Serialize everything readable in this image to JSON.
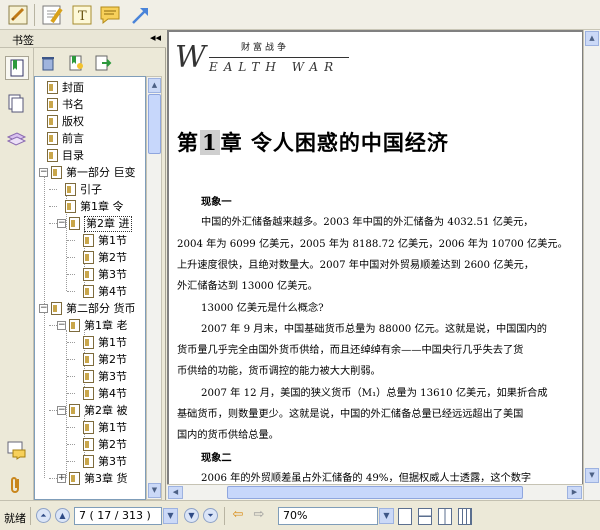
{
  "sidebar": {
    "title": "书签",
    "collapse_icon": "◂◂",
    "tree": [
      {
        "label": "封面",
        "level": 0
      },
      {
        "label": "书名",
        "level": 0
      },
      {
        "label": "版权",
        "level": 0
      },
      {
        "label": "前言",
        "level": 0
      },
      {
        "label": "目录",
        "level": 0
      },
      {
        "label": "第一部分  巨变",
        "level": 0,
        "expand": "−"
      },
      {
        "label": "引子",
        "level": 1
      },
      {
        "label": "第1章  令",
        "level": 1
      },
      {
        "label": "第2章  进",
        "level": 1,
        "expand": "−",
        "selected": true
      },
      {
        "label": "第1节",
        "level": 2
      },
      {
        "label": "第2节",
        "level": 2
      },
      {
        "label": "第3节",
        "level": 2
      },
      {
        "label": "第4节",
        "level": 2
      },
      {
        "label": "第二部分  货币",
        "level": 0,
        "expand": "−"
      },
      {
        "label": "第1章  老",
        "level": 1,
        "expand": "−"
      },
      {
        "label": "第1节",
        "level": 2
      },
      {
        "label": "第2节",
        "level": 2
      },
      {
        "label": "第3节",
        "level": 2
      },
      {
        "label": "第4节",
        "level": 2
      },
      {
        "label": "第2章  被",
        "level": 1,
        "expand": "−"
      },
      {
        "label": "第1节",
        "level": 2
      },
      {
        "label": "第2节",
        "level": 2
      },
      {
        "label": "第3节",
        "level": 2
      },
      {
        "label": "第3章  货",
        "level": 1,
        "expand": "+"
      }
    ]
  },
  "page": {
    "logo_cn": "财富战争",
    "logo_w": "W",
    "logo_rest": "EALTH  WAR",
    "chapter_prefix": "第",
    "chapter_num": "1",
    "chapter_suffix": "章  令人困惑的中国经济",
    "lines": [
      {
        "text": "现象一",
        "bold": true,
        "indent": 1
      },
      {
        "text": "中国的外汇储备越来越多。2003 年中国的外汇储备为 4032.51 亿美元，",
        "indent": 1
      },
      {
        "text": "2004 年为 6099 亿美元，2005 年为 8188.72 亿美元，2006 年为 10700 亿美元。",
        "indent": 0
      },
      {
        "text": "上升速度很快，且绝对数量大。2007 年中国对外贸易顺差达到 2600 亿美元，",
        "indent": 0
      },
      {
        "text": "外汇储备达到 13000 亿美元。",
        "indent": 0
      },
      {
        "text": "13000 亿美元是什么概念?",
        "indent": 1
      },
      {
        "text": "2007 年 9 月末，中国基础货币总量为 88000 亿元。这就是说，中国国内的",
        "indent": 1
      },
      {
        "text": "货币量几乎完全由国外货币供给，而且还绰绰有余——中国央行几乎失去了货",
        "indent": 0
      },
      {
        "text": "币供给的功能，货币调控的能力被大大削弱。",
        "indent": 0
      },
      {
        "text": "2007 年 12 月，美国的狭义货币（M₁）总量为 13610 亿美元，如果折合成",
        "indent": 1
      },
      {
        "text": "基础货币，则数量更少。这就是说，中国的外汇储备总量已经远远超出了美国",
        "indent": 0
      },
      {
        "text": "国内的货币供给总量。",
        "indent": 0
      },
      {
        "text": "现象二",
        "bold": true,
        "indent": 1
      },
      {
        "text": "2006 年的外贸顺差虽占外汇储备的 49%，但据权威人士透露，这个数字",
        "indent": 1
      }
    ]
  },
  "status": {
    "ready": "就绪",
    "page_current": "7",
    "page_of": "( 17 / 313 )",
    "zoom": "70%"
  },
  "colors": {
    "accent": "#2f6ad0",
    "tree_line": "#9b9b9b"
  }
}
